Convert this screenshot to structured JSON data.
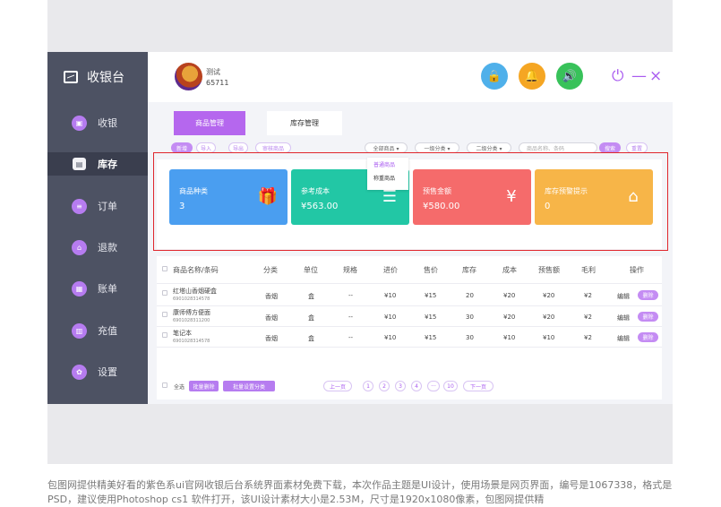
{
  "sidebar": {
    "title": "收银台",
    "items": [
      {
        "label": "收银",
        "icon": "register-icon"
      },
      {
        "label": "库存",
        "icon": "inventory-icon"
      },
      {
        "label": "订单",
        "icon": "order-icon"
      },
      {
        "label": "退款",
        "icon": "refund-icon"
      },
      {
        "label": "账单",
        "icon": "bill-icon"
      },
      {
        "label": "充值",
        "icon": "recharge-icon"
      },
      {
        "label": "设置",
        "icon": "settings-icon"
      }
    ]
  },
  "topbar": {
    "user_name": "测试",
    "user_id": "65711",
    "icons": {
      "lock": "🔒",
      "bell": "🔔",
      "sound": "🔊"
    },
    "power": "⏻",
    "minimize": "—",
    "close": "×"
  },
  "tabs": [
    {
      "label": "商品管理"
    },
    {
      "label": "库存管理"
    }
  ],
  "filters": {
    "buttons": [
      "新增",
      "导入",
      "导出",
      "审核商品"
    ],
    "category_select": "全部商品 ▾",
    "level1_select": "一级分类 ▾",
    "level2_select": "二级分类 ▾",
    "search_placeholder": "商品名称、条码",
    "search_btn": "搜索",
    "reset_btn": "重置"
  },
  "dropdown": {
    "options": [
      "普通商品",
      "称重商品"
    ]
  },
  "stats": [
    {
      "label": "商品种类",
      "value": "3",
      "color": "#4a9ef0",
      "icon": "gift-icon"
    },
    {
      "label": "参考成本",
      "value": "¥563.00",
      "color": "#22c7a5",
      "icon": "coins-icon"
    },
    {
      "label": "预售金额",
      "value": "¥580.00",
      "color": "#f56b6b",
      "icon": "money-bag-icon"
    },
    {
      "label": "库存预警提示",
      "value": "0",
      "color": "#f7b548",
      "icon": "warehouse-icon"
    }
  ],
  "table": {
    "headers": [
      "商品名称/条码",
      "分类",
      "单位",
      "规格",
      "进价",
      "售价",
      "库存",
      "成本",
      "预售额",
      "毛利",
      "操作"
    ],
    "rows": [
      {
        "name": "红塔山香烟硬盒",
        "code": "6901028314578",
        "category": "香烟",
        "unit": "盒",
        "spec": "--",
        "cost_price": "¥10",
        "sale_price": "¥15",
        "stock": "20",
        "cost": "¥20",
        "presale": "¥20",
        "profit": "¥2"
      },
      {
        "name": "康师傅方便面",
        "code": "6901028311200",
        "category": "香烟",
        "unit": "盒",
        "spec": "--",
        "cost_price": "¥10",
        "sale_price": "¥15",
        "stock": "30",
        "cost": "¥20",
        "presale": "¥20",
        "profit": "¥2"
      },
      {
        "name": "笔记本",
        "code": "6901028314578",
        "category": "香烟",
        "unit": "盒",
        "spec": "--",
        "cost_price": "¥10",
        "sale_price": "¥15",
        "stock": "30",
        "cost": "¥10",
        "presale": "¥10",
        "profit": "¥2"
      }
    ],
    "edit_label": "编辑",
    "delete_label": "删除"
  },
  "footer": {
    "select_all": "全选",
    "batch_delete": "批量删除",
    "batch_category": "批量设置分类",
    "pagination": [
      "上一页",
      "1",
      "2",
      "3",
      "4",
      "···",
      "10",
      "下一页"
    ]
  },
  "caption": "包图网提供精美好看的紫色系ui官网收银后台系统界面素材免费下载，本次作品主题是UI设计，使用场景是网页界面，编号是1067338，格式是PSD，建议使用Photoshop cs1 软件打开，该UI设计素材大小是2.53M，尺寸是1920x1080像素，包图网提供精"
}
